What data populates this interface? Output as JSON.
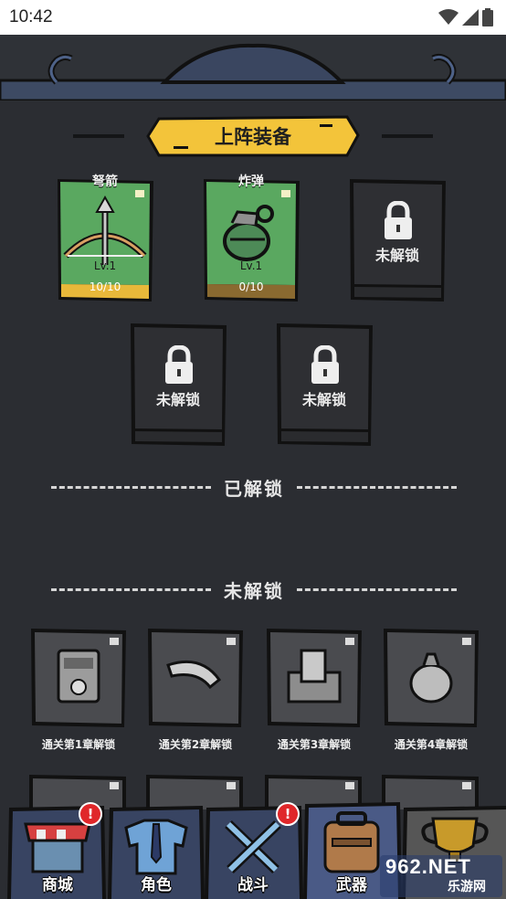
{
  "status_bar": {
    "time": "10:42"
  },
  "section_title": "上阵装备",
  "equipped": [
    {
      "name": "弩箭",
      "level": "Lv.1",
      "count": "10/10"
    },
    {
      "name": "炸弹",
      "level": "Lv.1",
      "count": "0/10"
    }
  ],
  "locked_label": "未解锁",
  "unlocked_header": "已解锁",
  "locked_header": "未解锁",
  "locked_items": [
    {
      "unlock": "通关第1章解锁"
    },
    {
      "unlock": "通关第2章解锁"
    },
    {
      "unlock": "通关第3章解锁"
    },
    {
      "unlock": "通关第4章解锁"
    }
  ],
  "nav": [
    {
      "label": "商城",
      "badge": "!"
    },
    {
      "label": "角色"
    },
    {
      "label": "战斗",
      "badge": "!"
    },
    {
      "label": "武器"
    }
  ],
  "watermark": {
    "logo": "962.NET",
    "site": "乐游网"
  },
  "colors": {
    "green_card": "#5aa860",
    "gold": "#e8b83a",
    "dark_card": "#2e2f33",
    "accent_yellow": "#f3c43a"
  }
}
